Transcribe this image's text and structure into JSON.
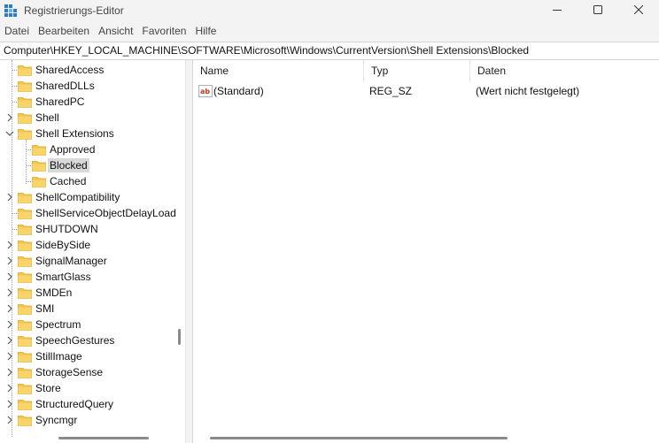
{
  "window": {
    "title": "Registrierungs-Editor",
    "icon": "registry-editor-icon"
  },
  "menu": {
    "items": [
      "Datei",
      "Bearbeiten",
      "Ansicht",
      "Favoriten",
      "Hilfe"
    ]
  },
  "address": {
    "path": "Computer\\HKEY_LOCAL_MACHINE\\SOFTWARE\\Microsoft\\Windows\\CurrentVersion\\Shell Extensions\\Blocked"
  },
  "tree": {
    "items": [
      {
        "label": "SharedAccess",
        "expander": "none"
      },
      {
        "label": "SharedDLLs",
        "expander": "none"
      },
      {
        "label": "SharedPC",
        "expander": "none"
      },
      {
        "label": "Shell",
        "expander": "collapsed"
      },
      {
        "label": "Shell Extensions",
        "expander": "expanded"
      },
      {
        "label": "Approved",
        "expander": "none"
      },
      {
        "label": "Blocked",
        "expander": "none",
        "selected": true
      },
      {
        "label": "Cached",
        "expander": "none"
      },
      {
        "label": "ShellCompatibility",
        "expander": "collapsed"
      },
      {
        "label": "ShellServiceObjectDelayLoad",
        "expander": "none"
      },
      {
        "label": "SHUTDOWN",
        "expander": "none"
      },
      {
        "label": "SideBySide",
        "expander": "collapsed"
      },
      {
        "label": "SignalManager",
        "expander": "collapsed"
      },
      {
        "label": "SmartGlass",
        "expander": "collapsed"
      },
      {
        "label": "SMDEn",
        "expander": "collapsed"
      },
      {
        "label": "SMI",
        "expander": "collapsed"
      },
      {
        "label": "Spectrum",
        "expander": "collapsed"
      },
      {
        "label": "SpeechGestures",
        "expander": "collapsed"
      },
      {
        "label": "StillImage",
        "expander": "collapsed"
      },
      {
        "label": "StorageSense",
        "expander": "collapsed"
      },
      {
        "label": "Store",
        "expander": "collapsed"
      },
      {
        "label": "StructuredQuery",
        "expander": "collapsed"
      },
      {
        "label": "Syncmgr",
        "expander": "collapsed"
      }
    ]
  },
  "list": {
    "columns": [
      "Name",
      "Typ",
      "Daten"
    ],
    "rows": [
      {
        "name": "(Standard)",
        "type": "REG_SZ",
        "data": "(Wert nicht festgelegt)",
        "icon": "string-value-icon"
      }
    ]
  },
  "colors": {
    "folder": "#f6c64a",
    "selection": "#d9d9d9",
    "accent": "#0067c0"
  }
}
